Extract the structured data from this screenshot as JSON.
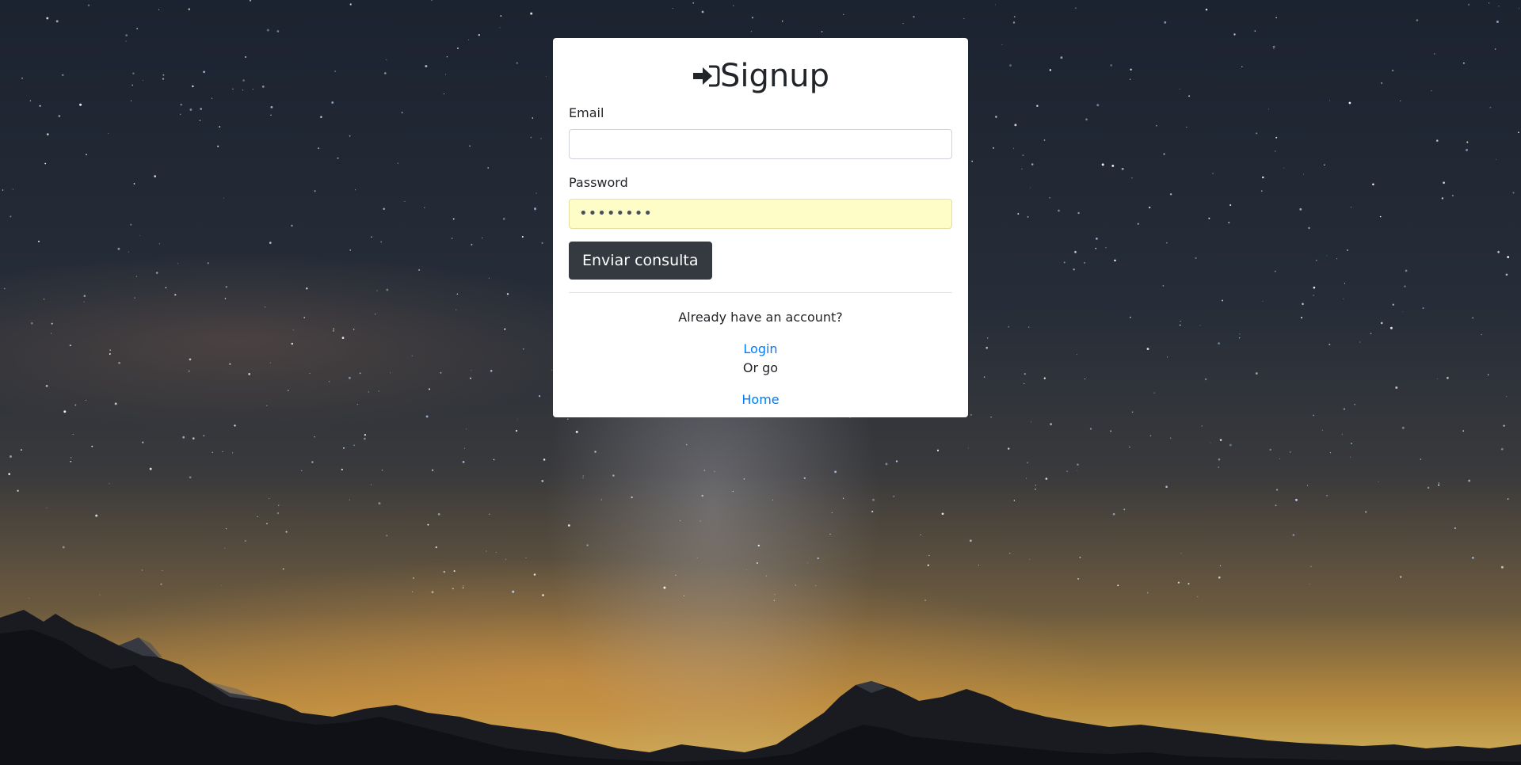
{
  "form": {
    "title": "Signup",
    "title_icon": "sign-in-icon",
    "email_label": "Email",
    "email_value": "",
    "password_label": "Password",
    "password_value": "••••••••",
    "submit_label": "Enviar consulta"
  },
  "footer": {
    "already_text": "Already have an account?",
    "login_link": "Login",
    "or_text": "Or go",
    "home_link": "Home"
  },
  "colors": {
    "link": "#007bff",
    "button": "#343a40",
    "autofill": "#fefdc8"
  }
}
